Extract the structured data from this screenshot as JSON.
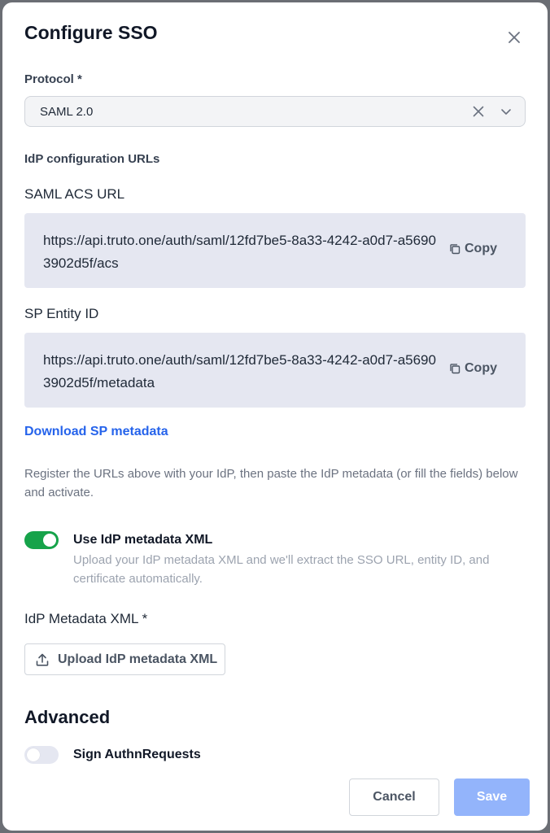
{
  "dialog": {
    "title": "Configure SSO"
  },
  "protocol": {
    "label": "Protocol *",
    "value": "SAML 2.0"
  },
  "idp_urls": {
    "heading": "IdP configuration URLs",
    "acs": {
      "label": "SAML ACS URL",
      "url": "https://api.truto.one/auth/saml/12fd7be5-8a33-4242-a0d7-a56903902d5f/acs",
      "copy_label": "Copy"
    },
    "entity": {
      "label": "SP Entity ID",
      "url": "https://api.truto.one/auth/saml/12fd7be5-8a33-4242-a0d7-a56903902d5f/metadata",
      "copy_label": "Copy"
    },
    "download_link": "Download SP metadata",
    "help_text": "Register the URLs above with your IdP, then paste the IdP metadata (or fill the fields) below and activate."
  },
  "metadata_toggle": {
    "title": "Use IdP metadata XML",
    "description": "Upload your IdP metadata XML and we'll extract the SSO URL, entity ID, and certificate automatically.",
    "on": true
  },
  "metadata_xml": {
    "label": "IdP Metadata XML *",
    "upload_label": "Upload IdP metadata XML"
  },
  "advanced": {
    "heading": "Advanced",
    "sign_requests_label": "Sign AuthnRequests",
    "sign_requests_on": false
  },
  "footer": {
    "cancel_label": "Cancel",
    "save_label": "Save"
  },
  "colors": {
    "primary": "#2563eb",
    "toggle_on": "#16a34a",
    "save_disabled": "#93b4fb",
    "url_box_bg": "#e5e7f1"
  },
  "icons": {
    "close": "close-icon",
    "clear": "clear-icon",
    "chevron": "chevron-down-icon",
    "copy": "copy-icon",
    "upload": "upload-icon"
  }
}
